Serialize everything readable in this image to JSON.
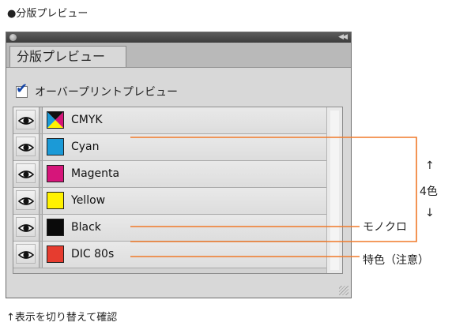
{
  "heading": "●分版プレビュー",
  "panel": {
    "tab_label": "分版プレビュー",
    "overprint_label": "オーバープリントプレビュー",
    "overprint_checked": true,
    "rows": [
      {
        "label": "CMYK",
        "swatch": "cmyk",
        "visible": true
      },
      {
        "label": "Cyan",
        "swatch": "#1b9ad7",
        "visible": true
      },
      {
        "label": "Magenta",
        "swatch": "#d6157a",
        "visible": true
      },
      {
        "label": "Yellow",
        "swatch": "#fff200",
        "visible": true
      },
      {
        "label": "Black",
        "swatch": "#0a0a0a",
        "visible": true
      },
      {
        "label": "DIC 80s",
        "swatch": "#e63c2f",
        "visible": true
      }
    ]
  },
  "annotations": {
    "up_arrow": "↑",
    "four_color": "4色",
    "down_arrow": "↓",
    "monochrome": "モノクロ",
    "spot_color": "特色（注意）",
    "line_color": "#f07a2a"
  },
  "bottom_note": "↑表示を切り替えて確認"
}
